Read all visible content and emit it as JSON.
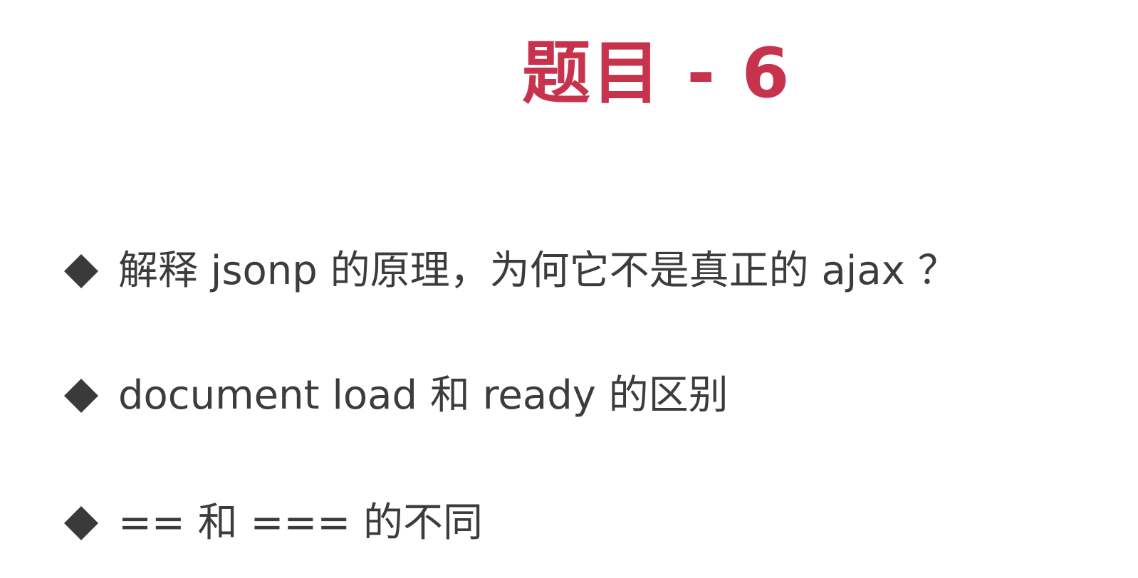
{
  "slide": {
    "title": "题目 - 6",
    "bullets": [
      {
        "text": "解释 jsonp 的原理，为何它不是真正的 ajax ？",
        "icon": "diamond-bullet-icon"
      },
      {
        "text": "document load 和 ready 的区别",
        "icon": "diamond-bullet-icon"
      },
      {
        "text": "== 和 === 的不同",
        "icon": "diamond-bullet-icon"
      }
    ]
  },
  "colors": {
    "title": "#c7324c",
    "text": "#3c3c3c",
    "bullet": "#3a3a3a",
    "background": "#ffffff"
  }
}
